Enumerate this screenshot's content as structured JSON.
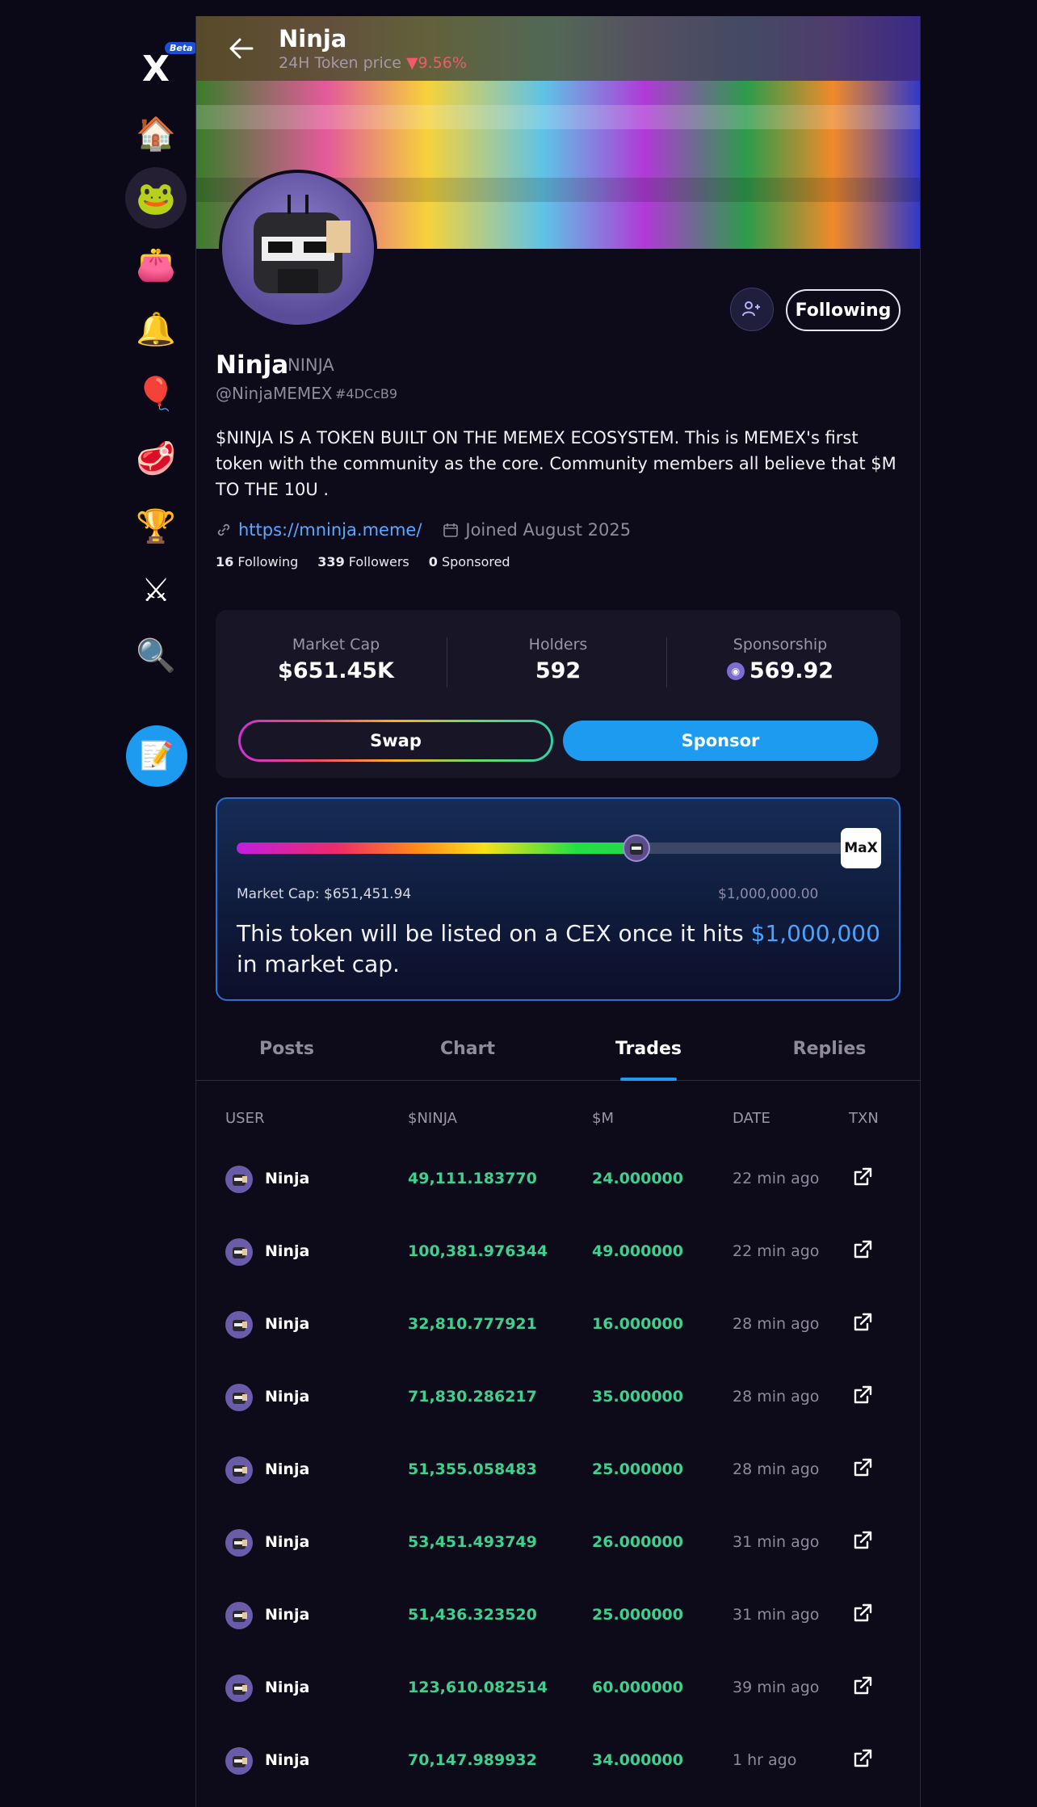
{
  "sidebar": {
    "logo_label": "X",
    "beta_badge": "Beta",
    "items": [
      {
        "icon": "home-icon",
        "glyph": "🏠"
      },
      {
        "icon": "token-avatar-icon",
        "glyph": "🐸"
      },
      {
        "icon": "wallet-icon",
        "glyph": "👛"
      },
      {
        "icon": "bell-icon",
        "glyph": "🔔"
      },
      {
        "icon": "balloon-icon",
        "glyph": "🎈"
      },
      {
        "icon": "meat-icon",
        "glyph": "🥩"
      },
      {
        "icon": "leaderboard-icon",
        "glyph": "🏆"
      },
      {
        "icon": "swords-icon",
        "glyph": "⚔"
      },
      {
        "icon": "search-icon",
        "glyph": "🔍"
      }
    ],
    "compose_glyph": "📝"
  },
  "header": {
    "name": "Ninja",
    "sub_label": "24H Token price ",
    "change": "▼9.56%"
  },
  "profile": {
    "name": "Ninja",
    "symbol": "NINJA",
    "handle": "@NinjaMEMEX",
    "id": "#4DCcB9",
    "bio": "$NINJA IS A TOKEN BUILT ON THE MEMEX ECOSYSTEM. This is MEMEX's first token with the community as the core. Community members all believe that $M TO THE 10U .",
    "link": "https://mninja.meme/",
    "joined": "Joined August 2025",
    "following_count": "16",
    "following_label": "Following",
    "followers_count": "339",
    "followers_label": "Followers",
    "sponsored_count": "0",
    "sponsored_label": "Sponsored",
    "follow_button": "Following"
  },
  "stats": {
    "market_cap_label": "Market Cap",
    "market_cap_value": "$651.45K",
    "holders_label": "Holders",
    "holders_value": "592",
    "sponsorship_label": "Sponsorship",
    "sponsorship_value": "569.92",
    "swap_label": "Swap",
    "sponsor_label": "Sponsor"
  },
  "cex": {
    "progress": 0.6515,
    "market_cap_text": "Market Cap: $651,451.94",
    "goal_text": "$1,000,000.00",
    "logo_text": "MaX",
    "msg_before": "This token will be listed on a CEX once it hits ",
    "msg_highlight": "$1,000,000",
    "msg_after": " in market cap."
  },
  "tabs": [
    "Posts",
    "Chart",
    "Trades",
    "Replies"
  ],
  "active_tab": 2,
  "trades": {
    "headers": {
      "user": "USER",
      "token": "$NINJA",
      "m": "$M",
      "date": "DATE",
      "txn": "TXN"
    },
    "rows": [
      {
        "user": "Ninja",
        "amount": "49,111.183770",
        "m": "24.000000",
        "date": "22 min ago"
      },
      {
        "user": "Ninja",
        "amount": "100,381.976344",
        "m": "49.000000",
        "date": "22 min ago"
      },
      {
        "user": "Ninja",
        "amount": "32,810.777921",
        "m": "16.000000",
        "date": "28 min ago"
      },
      {
        "user": "Ninja",
        "amount": "71,830.286217",
        "m": "35.000000",
        "date": "28 min ago"
      },
      {
        "user": "Ninja",
        "amount": "51,355.058483",
        "m": "25.000000",
        "date": "28 min ago"
      },
      {
        "user": "Ninja",
        "amount": "53,451.493749",
        "m": "26.000000",
        "date": "31 min ago"
      },
      {
        "user": "Ninja",
        "amount": "51,436.323520",
        "m": "25.000000",
        "date": "31 min ago"
      },
      {
        "user": "Ninja",
        "amount": "123,610.082514",
        "m": "60.000000",
        "date": "39 min ago"
      },
      {
        "user": "Ninja",
        "amount": "70,147.989932",
        "m": "34.000000",
        "date": "1 hr ago"
      }
    ]
  }
}
